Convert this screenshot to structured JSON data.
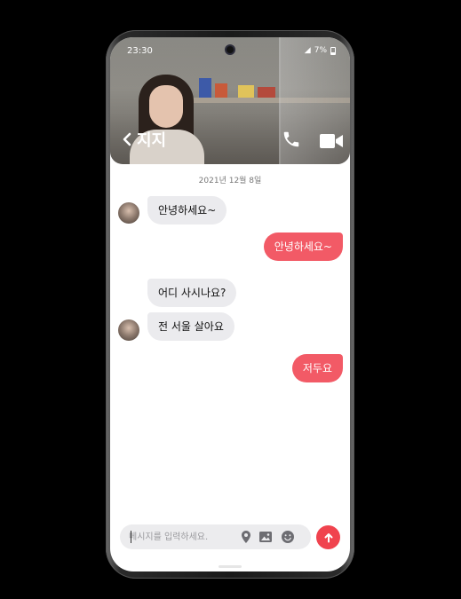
{
  "status_bar": {
    "time": "23:30",
    "battery": "7%"
  },
  "header": {
    "contact_name": "지지"
  },
  "chat": {
    "date": "2021년 12월 8일",
    "messages": [
      {
        "side": "in",
        "text": "안녕하세요~",
        "avatar": true
      },
      {
        "side": "out",
        "text": "안녕하세요~"
      },
      {
        "side": "in",
        "text": "어디 사시나요?",
        "avatar": false
      },
      {
        "side": "in",
        "text": "전 서울 살아요",
        "avatar": true
      },
      {
        "side": "out",
        "text": "저두요"
      }
    ]
  },
  "composer": {
    "placeholder": "메시지를 입력하세요."
  },
  "icons": {
    "back": "chevron-left-icon",
    "call": "phone-icon",
    "video": "video-camera-icon",
    "location": "location-pin-icon",
    "image": "image-icon",
    "emoji": "smiley-icon",
    "send": "arrow-up-icon"
  },
  "colors": {
    "accent": "#f25a66",
    "send": "#f0434e",
    "incoming": "#ebebee"
  }
}
